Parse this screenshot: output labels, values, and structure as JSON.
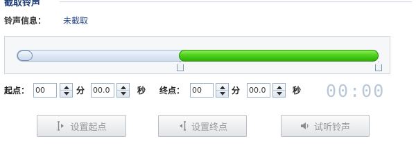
{
  "section": {
    "title": "截取铃声"
  },
  "info": {
    "label": "铃声信息：",
    "value": "未截取"
  },
  "slider": {
    "start_fraction": 0.0,
    "range_start_fraction": 0.45,
    "range_end_fraction": 1.0
  },
  "start": {
    "label": "起点：",
    "minutes": "00",
    "min_unit": "分",
    "seconds": "00.0",
    "sec_unit": "秒"
  },
  "end": {
    "label": "终点：",
    "minutes": "00",
    "min_unit": "分",
    "seconds": "00.0",
    "sec_unit": "秒"
  },
  "timer": "00:00",
  "buttons": {
    "set_start": "设置起点",
    "set_end": "设置终点",
    "preview": "试听铃声"
  },
  "colors": {
    "accent_green": "#4fd11f",
    "title_blue": "#1f3d7a",
    "timer_gray": "#b9c7d8"
  },
  "icons": {
    "set_start": "bracket-play-icon",
    "set_end": "play-left-bracket-icon",
    "preview": "speaker-icon"
  }
}
